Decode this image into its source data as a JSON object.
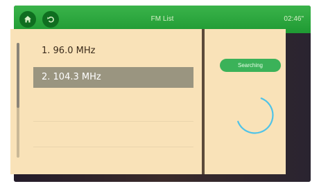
{
  "header": {
    "title": "FM List",
    "clock": "02:46\"",
    "home_icon": "home-icon",
    "back_icon": "back-icon"
  },
  "stations": [
    {
      "label": "1.  96.0 MHz",
      "selected": false
    },
    {
      "label": "2.  104.3 MHz",
      "selected": true
    }
  ],
  "status": {
    "badge": "Searching",
    "spinner_icon": "loading-spinner-icon"
  },
  "colors": {
    "header_green": "#2aa83d",
    "panel_bg": "#f9e2b8",
    "selected_row": "#9a9580",
    "badge_green": "#3bb259",
    "spinner": "#4fc3e8"
  }
}
